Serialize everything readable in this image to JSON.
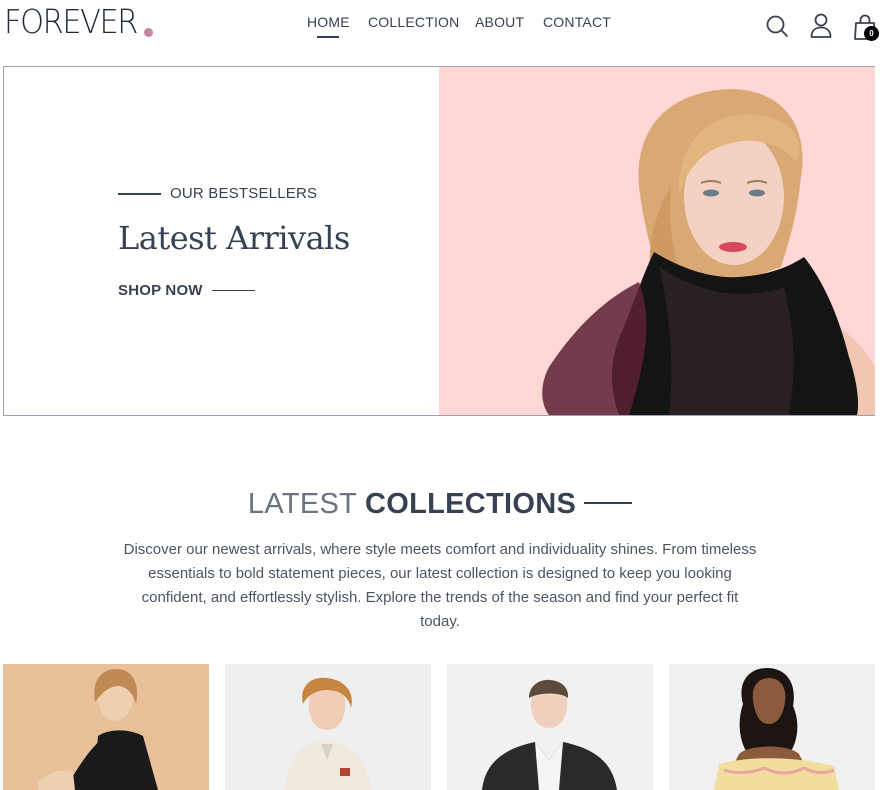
{
  "brand": {
    "name": "FOREVER",
    "accent_color": "#c586a5"
  },
  "nav": {
    "home": "HOME",
    "collection": "COLLECTION",
    "about": "ABOUT",
    "contact": "CONTACT",
    "active": "home"
  },
  "header_icons": {
    "search": "search-icon",
    "profile": "profile-icon",
    "cart": "cart-icon",
    "cart_count": "0"
  },
  "hero": {
    "eyebrow": "OUR BESTSELLERS",
    "title": "Latest Arrivals",
    "cta": "SHOP NOW",
    "image_bg": "#ffd7d6"
  },
  "latest_collections": {
    "title_light": "LATEST",
    "title_bold": "COLLECTIONS",
    "description": "Discover our newest arrivals, where style meets comfort and individuality shines. From timeless essentials to bold statement pieces, our latest collection is designed to keep you looking confident, and effortlessly stylish. Explore the trends of the season and find your perfect fit today."
  },
  "products": [
    {
      "bg": "#e8c19b"
    },
    {
      "bg": "#efefef"
    },
    {
      "bg": "#f1f1f1"
    },
    {
      "bg": "#f0f0f0"
    }
  ]
}
